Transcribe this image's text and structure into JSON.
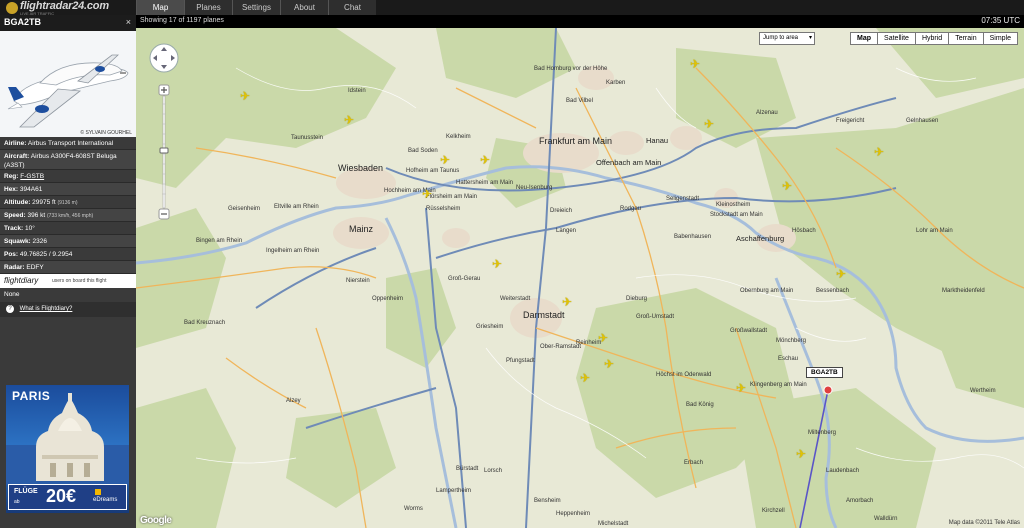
{
  "app": {
    "logo_text": "flightradar24.com",
    "logo_subtext": "LIVE AIR TRAFFIC"
  },
  "tabs": [
    {
      "label": "Map",
      "active": true
    },
    {
      "label": "Planes",
      "active": false
    },
    {
      "label": "Settings",
      "active": false
    },
    {
      "label": "About",
      "active": false
    },
    {
      "label": "Chat",
      "active": false
    }
  ],
  "status": {
    "showing": "Showing 17 of 1197 planes",
    "time": "07:35 UTC"
  },
  "flight": {
    "callsign": "BGA2TB",
    "close_label": "×",
    "photo_credit": "© SYLVAIN GOURHEL",
    "airline_label": "Airline:",
    "airline": "Airbus Transport International",
    "aircraft_label": "Aircraft:",
    "aircraft": "Airbus A300F4-608ST Beluga (A3ST)",
    "reg_label": "Reg:",
    "reg": "F-GSTB",
    "hex_label": "Hex:",
    "hex": "394A61",
    "altitude_label": "Altitude:",
    "altitude": "29975 ft",
    "altitude_metric": "(9136 m)",
    "speed_label": "Speed:",
    "speed": "396 kt",
    "speed_metric": "(733 km/h, 456 mph)",
    "track_label": "Track:",
    "track": "10°",
    "squawk_label": "Squawk:",
    "squawk": "2326",
    "pos_label": "Pos:",
    "pos": "49.76825 / 9.2954",
    "radar_label": "Radar:",
    "radar": "EDFY"
  },
  "flightdiary": {
    "logo": "flightdiary",
    "text": "users on board this flight",
    "none": "None",
    "help_icon": "?",
    "help_link": "What is Flightdiary?"
  },
  "ad": {
    "city": "PARIS",
    "line1": "FLÜGE",
    "line2": "ab",
    "price": "20€",
    "brand": "eDreams"
  },
  "map": {
    "jump_placeholder": "Jump to area",
    "types": [
      {
        "label": "Map",
        "active": true
      },
      {
        "label": "Satellite",
        "active": false
      },
      {
        "label": "Hybrid",
        "active": false
      },
      {
        "label": "Terrain",
        "active": false
      },
      {
        "label": "Simple",
        "active": false
      }
    ],
    "selected_callout": "BGA2TB",
    "google": "Google",
    "attribution": "Map data ©2011 Tele Atlas",
    "cities_big": [
      "Frankfurt am Main",
      "Wiesbaden",
      "Mainz",
      "Darmstadt",
      "Aschaffenburg",
      "Hanau",
      "Offenbach am Main"
    ],
    "cities_small": [
      "Bad Homburg vor der Höhe",
      "Bad Vilbel",
      "Karben",
      "Rüsselsheim",
      "Bensheim",
      "Heppenheim",
      "Worms",
      "Alzey",
      "Bad Kreuznach",
      "Bingen am Rhein",
      "Taunusstein",
      "Idstein",
      "Neu-Isenburg",
      "Langen",
      "Dreieich",
      "Dieburg",
      "Groß-Umstadt",
      "Erbach",
      "Michelstadt",
      "Miltenberg",
      "Amorbach",
      "Obernburg am Main",
      "Seligenstadt",
      "Rodgau",
      "Griesheim",
      "Weiterstadt",
      "Pfungstadt",
      "Groß-Gerau",
      "Ingelheim am Rhein",
      "Nierstein",
      "Oppenheim",
      "Eltville am Rhein",
      "Geisenheim",
      "Gelnhausen",
      "Freigericht",
      "Alzenau",
      "Bad Soden",
      "Kelkheim",
      "Hofheim am Taunus",
      "Hattersheim am Main",
      "Flörsheim am Main",
      "Hochheim am Main",
      "Lorsch",
      "Lampertheim",
      "Bürstadt",
      "Wertheim",
      "Lohr am Main",
      "Marktheidenfeld",
      "Bad König",
      "Höchst im Odenwald",
      "Reinheim",
      "Ober-Ramstadt",
      "Babenhausen",
      "Stockstadt am Main",
      "Kleinostheim",
      "Hösbach",
      "Bessenbach",
      "Eschau",
      "Klingenberg am Main",
      "Großwallstadt",
      "Mönchberg",
      "Laudenbach",
      "Kirchzell",
      "Walldürn"
    ],
    "plane_icon": "✈",
    "planes_count": 17
  }
}
